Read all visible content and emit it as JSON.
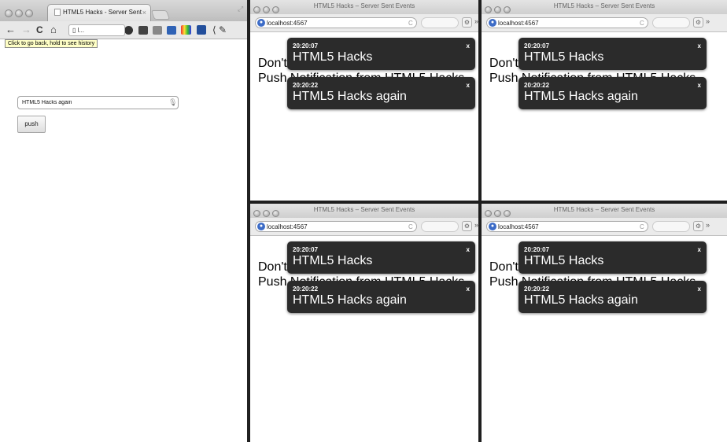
{
  "main_window": {
    "tab_title": "HTML5 Hacks - Server Sent",
    "tab_close": "×",
    "address": "l...",
    "tooltip": "Click to go back, hold to see history",
    "input_value": "HTML5 Hacks again",
    "push_label": "push",
    "icons": {
      "back": "←",
      "forward": "→",
      "reload": "C",
      "home": "⌂",
      "bookmark": "☆",
      "wrench": "🔧"
    }
  },
  "sse_window": {
    "title": "HTML5 Hacks – Server Sent Events",
    "address": "localhost:4567",
    "reload": "C",
    "more": "»",
    "page_text": "Don't Mind Me... Just Waiting for a Push Notification from HTML5 Hacks.",
    "notifications": [
      {
        "time": "20:20:07",
        "message": "HTML5 Hacks",
        "close": "x"
      },
      {
        "time": "20:20:22",
        "message": "HTML5 Hacks again",
        "close": "x"
      }
    ]
  }
}
